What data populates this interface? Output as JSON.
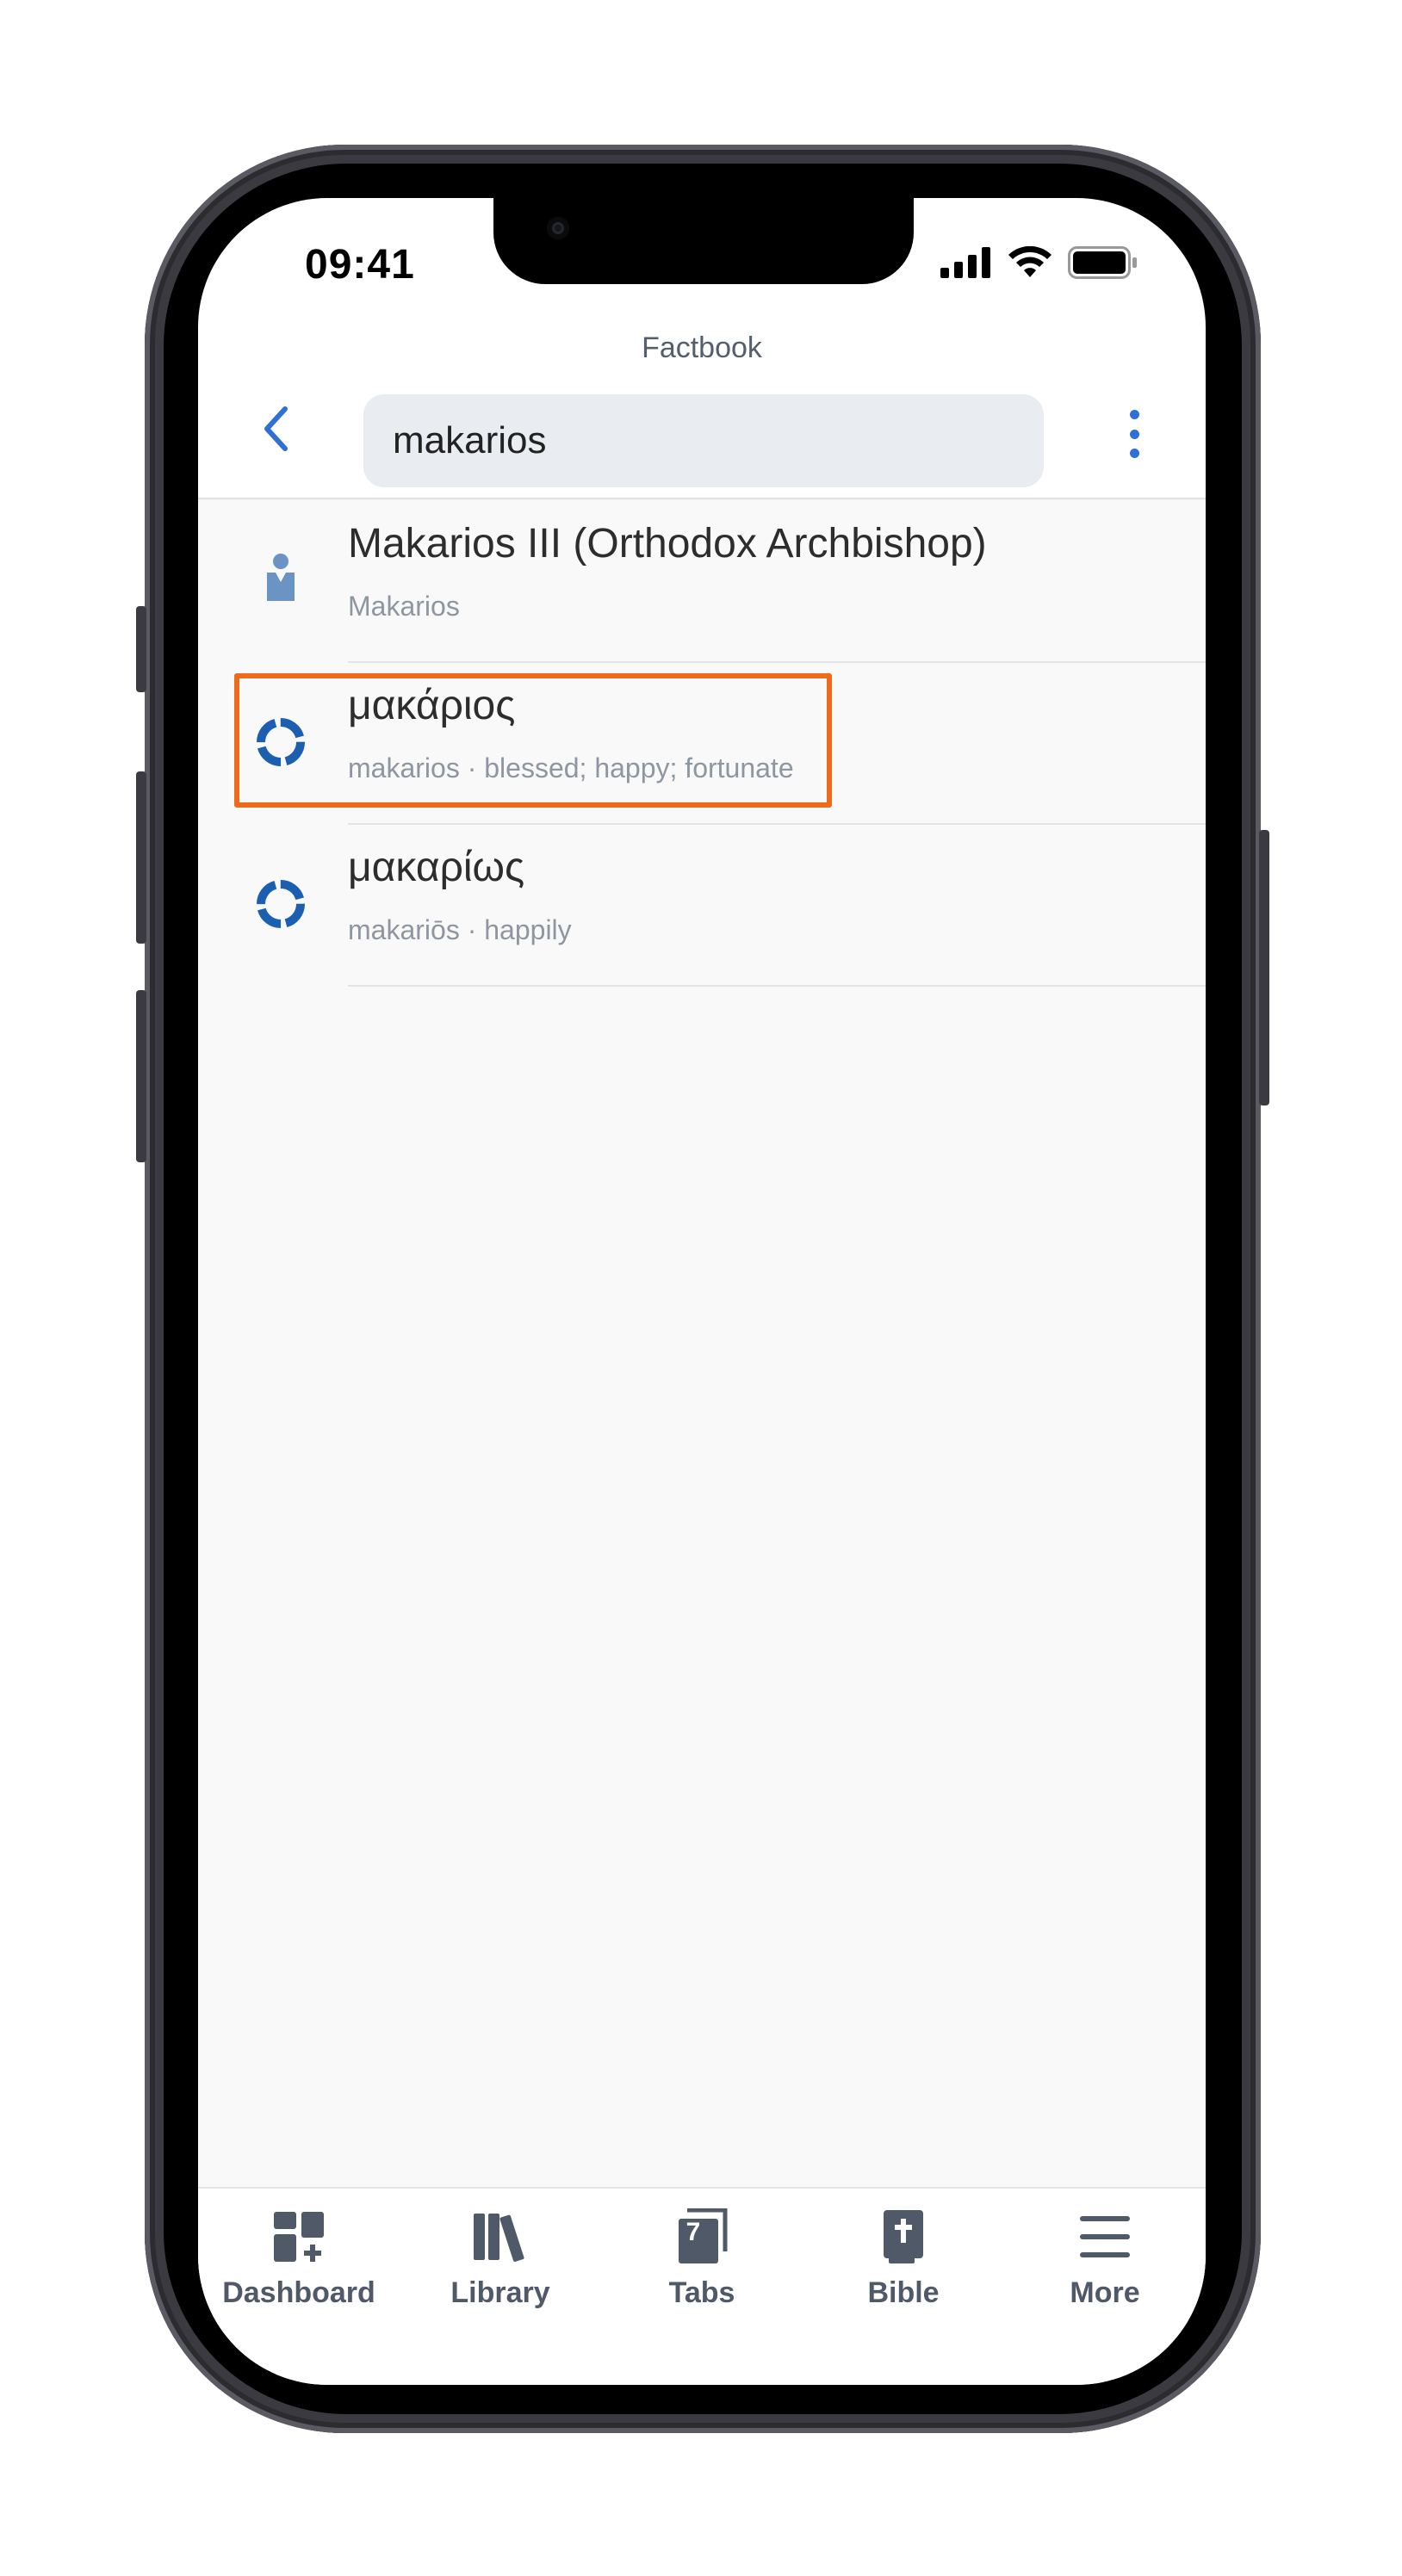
{
  "status_bar": {
    "time": "09:41",
    "icons": [
      "cellular-signal-icon",
      "wifi-icon",
      "battery-icon"
    ]
  },
  "header": {
    "title": "Factbook",
    "back_icon": "chevron-left-icon",
    "search_value": "makarios",
    "menu_icon": "vertical-ellipsis-icon"
  },
  "results": [
    {
      "icon": "person-icon",
      "title": "Makarios III (Orthodox Archbishop)",
      "subtitle": "Makarios"
    },
    {
      "icon": "lemma-ring-icon",
      "title": "μακάριος",
      "subtitle": "makarios · blessed; happy; fortunate",
      "highlighted": true
    },
    {
      "icon": "lemma-ring-icon",
      "title": "μακαρίως",
      "subtitle": "makariōs · happily"
    }
  ],
  "tab_bar": {
    "items": [
      {
        "label": "Dashboard",
        "icon": "dashboard-icon"
      },
      {
        "label": "Library",
        "icon": "library-icon"
      },
      {
        "label": "Tabs",
        "icon": "tabs-icon",
        "badge": "7"
      },
      {
        "label": "Bible",
        "icon": "bible-icon"
      },
      {
        "label": "More",
        "icon": "hamburger-menu-icon"
      }
    ]
  },
  "colors": {
    "accent": "#2f6fd6",
    "highlight_border": "#ef6a19",
    "lemma_icon": "#1c5fb0",
    "person_icon": "#6b93c4",
    "tab_icon": "#4f5968"
  }
}
